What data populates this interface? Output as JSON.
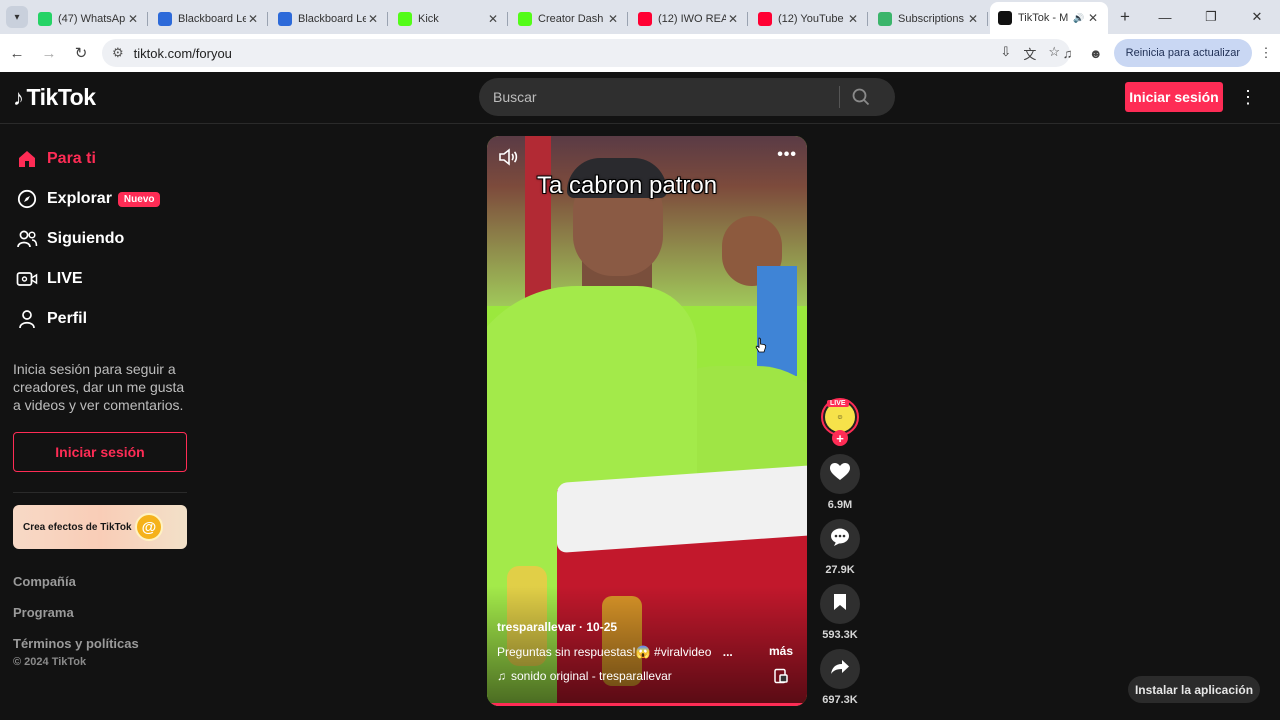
{
  "browser": {
    "tabs": [
      {
        "title": "(47) WhatsApp",
        "favicon": "whatsapp-icon",
        "color": "#25d366"
      },
      {
        "title": "Blackboard Le",
        "favicon": "blackboard-icon",
        "color": "#2d6ad9"
      },
      {
        "title": "Blackboard Le",
        "favicon": "blackboard-icon",
        "color": "#2d6ad9"
      },
      {
        "title": "Kick",
        "favicon": "kick-icon",
        "color": "#53fc18"
      },
      {
        "title": "Creator Dash",
        "favicon": "kick-icon",
        "color": "#53fc18"
      },
      {
        "title": "(12) IWO REA",
        "favicon": "youtube-icon",
        "color": "#ff0033"
      },
      {
        "title": "(12) YouTube",
        "favicon": "youtube-icon",
        "color": "#ff0033"
      },
      {
        "title": "Subscriptions",
        "favicon": "subscriptions-icon",
        "color": "#3bb56b"
      },
      {
        "title": "TikTok - M",
        "favicon": "tiktok-icon",
        "color": "#111111"
      }
    ],
    "url": "tiktok.com/foryou",
    "update_label": "Reinicia para actualizar"
  },
  "header": {
    "logo_text": "TikTok",
    "search_placeholder": "Buscar",
    "login_label": "Iniciar sesión"
  },
  "sidebar": {
    "items": [
      {
        "label": "Para ti",
        "icon": "home-icon",
        "active": true
      },
      {
        "label": "Explorar",
        "icon": "compass-icon",
        "badge": "Nuevo"
      },
      {
        "label": "Siguiendo",
        "icon": "following-icon"
      },
      {
        "label": "LIVE",
        "icon": "live-icon"
      },
      {
        "label": "Perfil",
        "icon": "profile-icon"
      }
    ],
    "hint": "Inicia sesión para seguir a creadores, dar un me gusta a videos y ver comentarios.",
    "login_label": "Iniciar sesión",
    "effects_label": "Crea efectos de TikTok",
    "footer_links": [
      "Compañía",
      "Programa",
      "Términos y políticas"
    ],
    "copyright": "© 2024 TikTok"
  },
  "video": {
    "caption": "Ta cabron patron",
    "author": "tresparallevar · 10-25",
    "description": "Preguntas sin respuestas!😱 #viralvideo",
    "ellipsis": "...",
    "more_label": "más",
    "music": "sonido original - tresparallevar",
    "progress": 0.99
  },
  "actions": {
    "live_tag": "LIVE",
    "likes": "6.9M",
    "comments": "27.9K",
    "saves": "593.3K",
    "shares": "697.3K"
  },
  "install_label": "Instalar la aplicación",
  "colors": {
    "accent": "#fe2c55",
    "background": "#121212"
  }
}
